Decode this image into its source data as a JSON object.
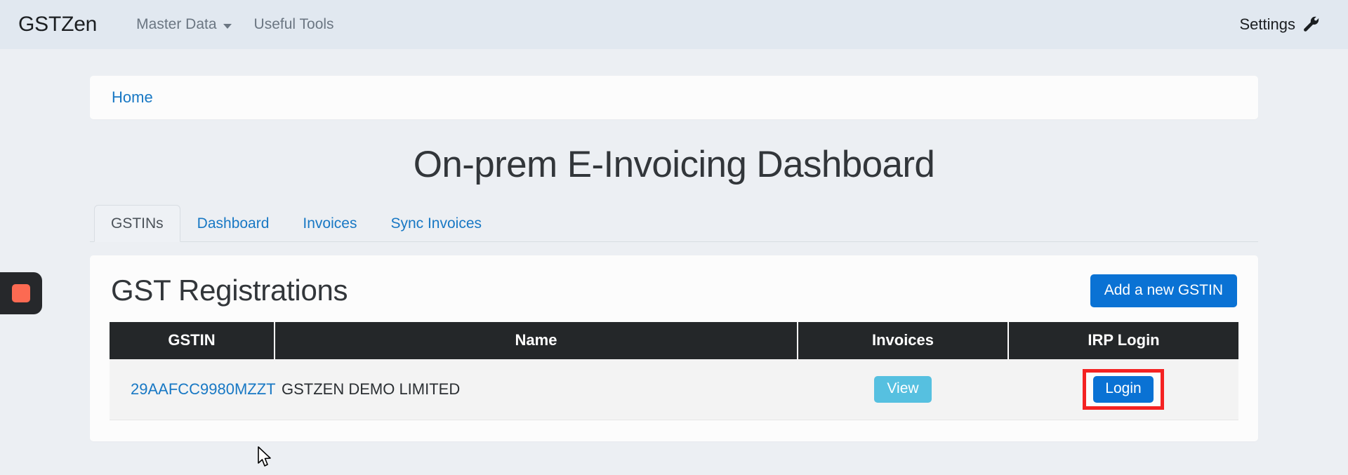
{
  "navbar": {
    "brand": "GSTZen",
    "items": [
      {
        "label": "Master Data",
        "has_caret": true
      },
      {
        "label": "Useful Tools",
        "has_caret": false
      }
    ],
    "settings_label": "Settings",
    "settings_icon": "wrench-icon"
  },
  "breadcrumb": {
    "items": [
      {
        "label": "Home"
      }
    ]
  },
  "page": {
    "title": "On-prem E-Invoicing Dashboard"
  },
  "tabs": [
    {
      "label": "GSTINs",
      "active": true
    },
    {
      "label": "Dashboard",
      "active": false
    },
    {
      "label": "Invoices",
      "active": false
    },
    {
      "label": "Sync Invoices",
      "active": false
    }
  ],
  "card": {
    "title": "GST Registrations",
    "add_button_label": "Add a new GSTIN"
  },
  "table": {
    "headers": [
      "GSTIN",
      "Name",
      "Invoices",
      "IRP Login"
    ],
    "rows": [
      {
        "gstin": "29AAFCC9980MZZT",
        "name": "GSTZEN DEMO LIMITED",
        "invoices_button": "View",
        "irp_login_button": "Login"
      }
    ]
  },
  "recorder": {
    "icon": "stop-recording-icon"
  },
  "colors": {
    "navbar_bg": "#e1e8f0",
    "page_bg": "#eceff3",
    "link_blue": "#1878c4",
    "primary_blue": "#0a72d4",
    "info_blue": "#56c0e0",
    "table_header_bg": "#242729",
    "highlight_red": "#f42222",
    "recorder_red": "#fc6a52"
  }
}
